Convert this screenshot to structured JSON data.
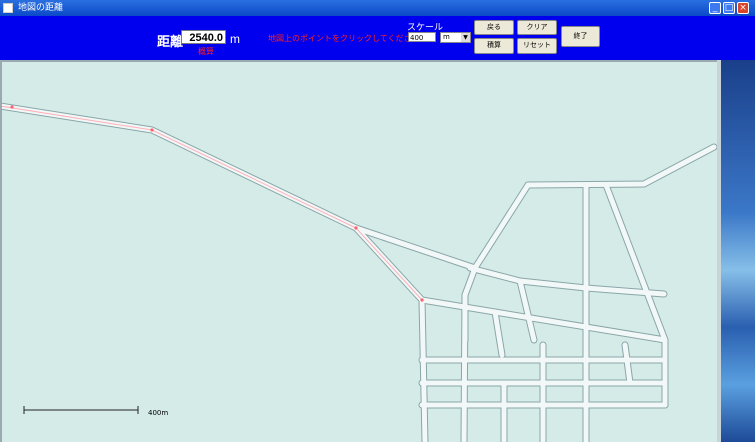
{
  "window": {
    "title": "地図の距離"
  },
  "toolbar": {
    "distance_label": "距離",
    "distance_value": "2540.0",
    "unit": "m",
    "red_note": "概算",
    "instruction": "地図上のポイントをクリックしてください",
    "scale_label": "スケール",
    "scale_value": "400",
    "scale_unit": "m",
    "back_label": "戻る",
    "clear_label": "クリア",
    "exit_label": "終了",
    "area_label": "積算",
    "reset_label": "リセット"
  },
  "map": {
    "scale_bar_label": "400m"
  },
  "colors": {
    "toolbar_bg": "#0000ee",
    "map_bg": "#d4ebe8",
    "road": "#f2f8f8"
  }
}
